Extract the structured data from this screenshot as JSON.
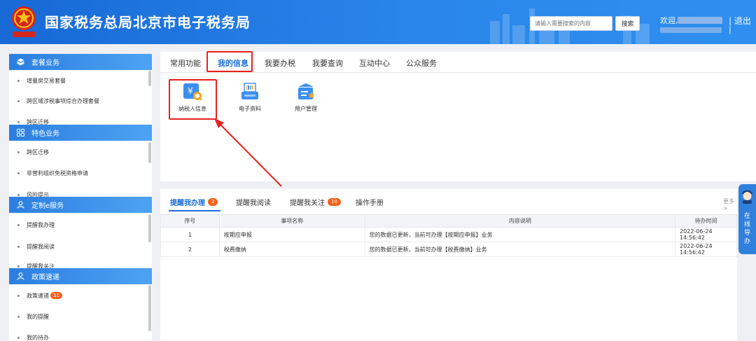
{
  "header": {
    "title": "国家税务总局北京市电子税务局",
    "search_placeholder": "请输入需要搜索的内容",
    "search_button": "搜索",
    "welcome": "欢迎,",
    "logout": "| 退出",
    "logout_bar": "|"
  },
  "sidebar": {
    "sections": [
      {
        "title": "套餐业务",
        "icon": "box-icon",
        "items": [
          "增量房交易套餐",
          "跨区域涉税事项综合办理套餐",
          "跨区迁移"
        ]
      },
      {
        "title": "特色业务",
        "icon": "grid-icon",
        "items": [
          "跨区迁移",
          "非营利组织免税资格申请",
          "风险提示"
        ]
      },
      {
        "title": "定制e服务",
        "icon": "user-icon",
        "items": [
          "提醒我办理",
          "提醒我阅读",
          "提醒我关注"
        ]
      },
      {
        "title": "政策速递",
        "icon": "user-icon",
        "items": [
          "政策速递",
          "我的提醒",
          "我的待办"
        ],
        "badge": "11"
      }
    ]
  },
  "top_tabs": [
    "常用功能",
    "我的信息",
    "我要办税",
    "我要查询",
    "互动中心",
    "公众服务"
  ],
  "active_top_tab": "我的信息",
  "functions": [
    {
      "label": "纳税人信息",
      "icon": "taxpayer-info-icon"
    },
    {
      "label": "电子资料",
      "icon": "electronic-docs-icon"
    },
    {
      "label": "用户管理",
      "icon": "user-management-icon"
    }
  ],
  "bottom_tabs": [
    {
      "label": "提醒我办理",
      "count": "2"
    },
    {
      "label": "提醒我阅读",
      "count": ""
    },
    {
      "label": "提醒我关注",
      "count": "10"
    },
    {
      "label": "操作手册",
      "count": ""
    }
  ],
  "more": "更多>",
  "table": {
    "headers": [
      "序号",
      "事项名称",
      "内容说明",
      "待办时间"
    ],
    "rows": [
      [
        "1",
        "按期应申报",
        "您的数据已更新，当前可办理【按期应申报】业务",
        "2022-06-24 14:56:42"
      ],
      [
        "2",
        "税费缴纳",
        "您的数据已更新，当前可办理【税费缴纳】业务",
        "2022-06-24 14:56:42"
      ]
    ]
  },
  "online_guide": "在线导办",
  "colors": {
    "brand_blue": "#1e6fd9",
    "highlight_red": "#e8211d",
    "badge_orange": "#f2631c"
  }
}
